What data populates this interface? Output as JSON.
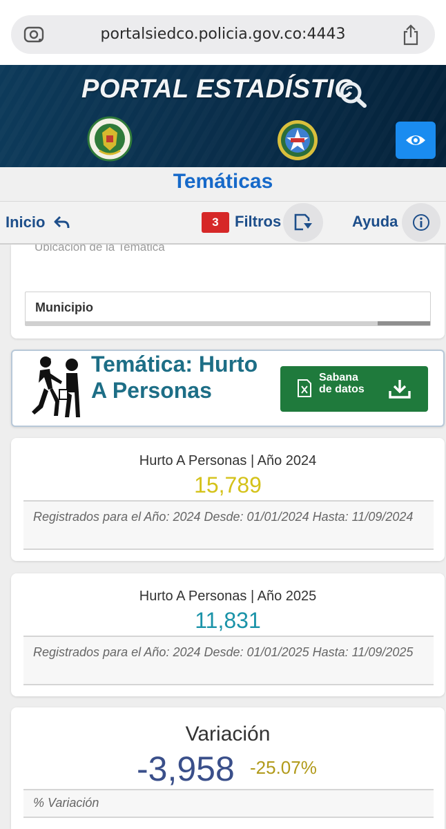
{
  "browser": {
    "url": "portalsiedco.policia.gov.co:4443"
  },
  "header": {
    "title": "PORTAL ESTADÍSTIC"
  },
  "page": {
    "title": "Temáticas"
  },
  "nav": {
    "inicio_label": "Inicio",
    "filter_count": "3",
    "filtros_label": "Filtros",
    "ayuda_label": "Ayuda"
  },
  "location": {
    "section_label": "Ubicación de la Temática",
    "municipio_label": "Municipio"
  },
  "tematica": {
    "title": "Temática: Hurto A Personas",
    "download_label": "Sabana de datos"
  },
  "stats": [
    {
      "title": "Hurto A Personas | Año 2024",
      "value": "15,789",
      "note": "Registrados para el Año: 2024 Desde: 01/01/2024 Hasta: 11/09/2024"
    },
    {
      "title": "Hurto A Personas | Año 2025",
      "value": "11,831",
      "note": "Registrados para el Año: 2024 Desde: 01/01/2025 Hasta: 11/09/2025"
    }
  ],
  "variation": {
    "title": "Variación",
    "value": "-3,958",
    "percent": "-25.07%",
    "note": "% Variación"
  },
  "colors": {
    "brand_blue": "#1669c9",
    "nav_text": "#1d4e8a",
    "badge_red": "#d62828",
    "download_green": "#1f7a3c",
    "value_2024": "#d4c21a",
    "value_2025": "#1a93a8",
    "variation_value": "#3a4f8a",
    "variation_percent": "#b19a1a",
    "eye_button": "#1a8cf0"
  },
  "icons": [
    "lens-icon",
    "share-icon",
    "search-lens-icon",
    "police-seal-icon",
    "dijin-seal-icon",
    "eye-icon",
    "back-arrow-icon",
    "filter-icon",
    "help-icon",
    "theft-icon",
    "excel-icon",
    "download-icon"
  ]
}
